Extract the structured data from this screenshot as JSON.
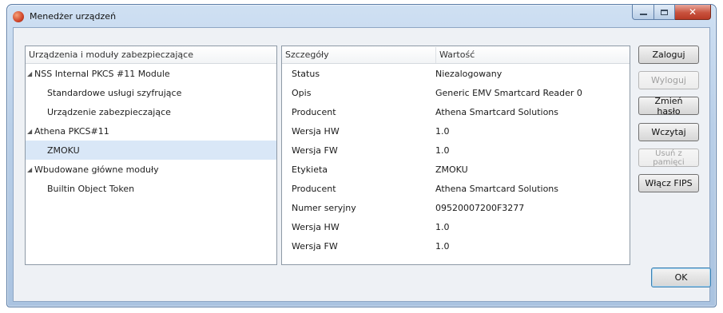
{
  "window": {
    "title": "Menedżer urządzeń"
  },
  "devices": {
    "header": "Urządzenia i moduły zabezpieczające",
    "rows": [
      {
        "label": "NSS Internal PKCS #11 Module",
        "expanded": true,
        "level": 0
      },
      {
        "label": "Standardowe usługi szyfrujące",
        "level": 1
      },
      {
        "label": "Urządzenie zabezpieczające",
        "level": 1
      },
      {
        "label": "Athena PKCS#11",
        "expanded": true,
        "level": 0
      },
      {
        "label": "ZMOKU",
        "level": 1,
        "selected": true
      },
      {
        "label": "Wbudowane główne moduły",
        "expanded": true,
        "level": 0
      },
      {
        "label": "Builtin Object Token",
        "level": 1
      }
    ]
  },
  "details": {
    "header_name": "Szczegóły",
    "header_value": "Wartość",
    "rows": [
      {
        "name": "Status",
        "value": "Niezalogowany"
      },
      {
        "name": "Opis",
        "value": "Generic EMV Smartcard Reader 0"
      },
      {
        "name": "Producent",
        "value": "Athena Smartcard Solutions"
      },
      {
        "name": "Wersja HW",
        "value": "1.0"
      },
      {
        "name": "Wersja FW",
        "value": "1.0"
      },
      {
        "name": "Etykieta",
        "value": "ZMOKU"
      },
      {
        "name": "Producent",
        "value": "Athena Smartcard Solutions"
      },
      {
        "name": "Numer seryjny",
        "value": "09520007200F3277"
      },
      {
        "name": "Wersja HW",
        "value": "1.0"
      },
      {
        "name": "Wersja FW",
        "value": "1.0"
      }
    ]
  },
  "buttons": {
    "login": "Zaloguj",
    "logout": "Wyloguj",
    "change_password": "Zmień hasło",
    "load": "Wczytaj",
    "unload": "Usuń z pamięci",
    "enable_fips": "Włącz FIPS",
    "ok": "OK"
  },
  "icons": {
    "app": "firefox-icon",
    "minimize": "minimize-icon",
    "maximize": "maximize-icon",
    "close": "close-icon",
    "expand": "expanded-triangle-icon"
  }
}
